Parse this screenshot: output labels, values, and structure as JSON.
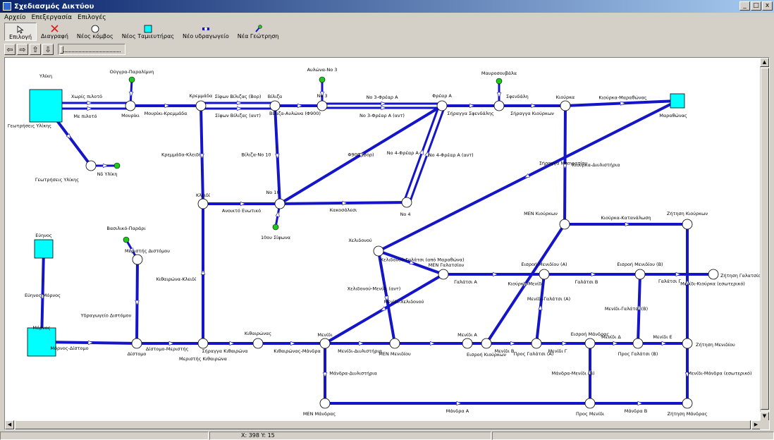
{
  "window": {
    "title": "Σχεδιασμός Δικτύου",
    "buttons": [
      "_",
      "□",
      "x"
    ]
  },
  "menu": [
    "Αρχείο",
    "Επεξεργασία",
    "Επιλογές"
  ],
  "toolbar": [
    {
      "label": "Επιλογή",
      "icon": "cursor-icon",
      "active": true
    },
    {
      "label": "Διαγραφή",
      "icon": "delete-x-icon",
      "active": false
    },
    {
      "label": "Νέος κόμβος",
      "icon": "node-circle-icon",
      "active": false
    },
    {
      "label": "Νέος Ταμιευτήρας",
      "icon": "reservoir-square-icon",
      "active": false
    },
    {
      "label": "Νέο υδραγωγείο",
      "icon": "aqueduct-icon",
      "active": false
    },
    {
      "label": "Νέα Γεώτρηση",
      "icon": "borehole-icon",
      "active": false
    }
  ],
  "nav": [
    "⇦",
    "⇨",
    "⇧",
    "⇩"
  ],
  "status": {
    "coords": "X: 398 Y: 15"
  },
  "colors": {
    "link": "#1414c8",
    "node_fill": "#ffffff",
    "reservoir": "#00ffff",
    "borehole": "#1ec81e"
  },
  "network": {
    "nodes": [
      {
        "id": "ylikis",
        "label": "Υλίκη",
        "type": "reservoir"
      },
      {
        "id": "mourikio",
        "label": "Μουρίκι",
        "type": "node"
      },
      {
        "id": "oygg",
        "label": "Ούγγρα-Παραλίμνη",
        "type": "borehole"
      },
      {
        "id": "kremmida",
        "label": "Κρεμμάδα",
        "type": "node"
      },
      {
        "id": "vilitza",
        "label": "Βίλιζα",
        "type": "node"
      },
      {
        "id": "avl",
        "label": "Αυλώνα-Νο 3",
        "type": "borehole"
      },
      {
        "id": "no3",
        "label": "Νο 3",
        "type": "node"
      },
      {
        "id": "freara",
        "label": "Φρέαρ Α",
        "type": "node"
      },
      {
        "id": "mavros",
        "label": "Μαυροσουβάλα",
        "type": "borehole"
      },
      {
        "id": "sfend",
        "label": "Σφενδάλη",
        "type": "node"
      },
      {
        "id": "kiourka",
        "label": "Κιούρκα",
        "type": "node"
      },
      {
        "id": "marath",
        "label": "Μαραθώνας",
        "type": "reservoir"
      },
      {
        "id": "geoyl",
        "label": "Γεωτρήσεις Υλίκης",
        "type": "node"
      },
      {
        "id": "ndyl",
        "label": "Νδ Υλίκη",
        "type": "borehole"
      },
      {
        "id": "kleidi",
        "label": "Κλειδί",
        "type": "node"
      },
      {
        "id": "no10",
        "label": "Νο 10",
        "type": "node"
      },
      {
        "id": "sifona10",
        "label": "10ου Σίφωνα",
        "type": "borehole"
      },
      {
        "id": "no4",
        "label": "Νο 4",
        "type": "node"
      },
      {
        "id": "menkiou",
        "label": "ΜΕΝ Κιούρκων",
        "type": "node"
      },
      {
        "id": "zitkiou",
        "label": "Ζήτηση Κιούρκων",
        "type": "node"
      },
      {
        "id": "chelid",
        "label": "Χελιδονού",
        "type": "node"
      },
      {
        "id": "mengal",
        "label": "ΜΕΝ Γαλατσίου",
        "type": "node"
      },
      {
        "id": "eismenA",
        "label": "Εισροή Μενιδίου (Α)",
        "type": "node"
      },
      {
        "id": "eismenB",
        "label": "Εισροή Μενιδίου (Β)",
        "type": "node"
      },
      {
        "id": "zitgal",
        "label": "Ζήτηση Γαλατσίου",
        "type": "node"
      },
      {
        "id": "evinos",
        "label": "Εύηνος",
        "type": "reservoir"
      },
      {
        "id": "vasil",
        "label": "Βασιλικό-Παράρι",
        "type": "borehole"
      },
      {
        "id": "merdist",
        "label": "Μεριστής Διστόμου",
        "type": "node"
      },
      {
        "id": "mornos",
        "label": "Μόρνος",
        "type": "reservoir"
      },
      {
        "id": "distomo",
        "label": "Δίστομο",
        "type": "node"
      },
      {
        "id": "merkith",
        "label": "Μεριστής Κιθαιρώνα",
        "type": "node"
      },
      {
        "id": "kithair",
        "label": "Κιθαιρώνας",
        "type": "node"
      },
      {
        "id": "menidi",
        "label": "Μενίδι",
        "type": "node"
      },
      {
        "id": "menmen",
        "label": "ΜΕΝ Μενιδίου",
        "type": "node"
      },
      {
        "id": "menidiA",
        "label": "Μενίδι Α",
        "type": "node"
      },
      {
        "id": "eiskiou",
        "label": "Εισροή Κιούρκων",
        "type": "node"
      },
      {
        "id": "prosgalA",
        "label": "Προς Γαλάτσι (Α)",
        "type": "node"
      },
      {
        "id": "eismandra",
        "label": "Εισροή Μάνδρας",
        "type": "node"
      },
      {
        "id": "prosgalB",
        "label": "Προς Γαλάτσι (Β)",
        "type": "node"
      },
      {
        "id": "zitmen",
        "label": "Ζήτηση Μενιδίου",
        "type": "node"
      },
      {
        "id": "menmandra",
        "label": "ΜΕΝ Μάνδρας",
        "type": "node"
      },
      {
        "id": "prosmen",
        "label": "Προς Μενίδι",
        "type": "node"
      },
      {
        "id": "zitmandra",
        "label": "Ζήτηση Μάνδρας",
        "type": "node"
      }
    ],
    "link_labels": [
      "Χωρίς πιλοτό",
      "Με πιλοτό",
      "Μουρίκι-Κρεμμάδα",
      "Σίφων Βίλιζας (Βορ)",
      "Σίφων Βίλιζας (ανт)",
      "Βίλιζα-Αυλώνα (Φ900)",
      "Νο 3-Φρέαρ Α",
      "Νο 3-Φρέαρ Α (ανт)",
      "Σήραγγα Σφενδάλης",
      "Σήραγγα Κιούρκων",
      "Κιούρκα-Μαραθώνας",
      "Γεωτρήσεις Υλίκης",
      "Κρεμμάδα-Κλειδί",
      "Βίλιζα-Νο 10",
      "Φ900 (Βορ)",
      "Νο 4-Φρέαρ Α",
      "Νο 4-Φρέαρ Α (ανт)",
      "Κιούρκα-Διυλιστήρια",
      "Σήραγγα Μπογιατίου",
      "Ανοικτό Ενωτικό",
      "Κακοσάλεσι",
      "Κιούρκα-Κατανάλωση",
      "Χελιδονού-Γαλάτσι (από Μαραθώνα)",
      "Κιούρκα-Μενίδι",
      "Γαλάτσι Α",
      "Γαλάτσι Β",
      "Γαλάτσι Γ",
      "Μενίδι-Κιούρκα (εσωτερικό)",
      "Χελιδονού-Μενίδι (ανт)",
      "Μενίδι-Χελιδονού",
      "Μενίδι-Γαλάτσι (Β)",
      "Μενίδι-Γαλάτσι (Α)",
      "Εύηνος-Μόρνος",
      "Υδραγωγείο Διστόμου",
      "Κιθαιρώνα-Κλειδί",
      "Μόρνος-Δίστομο",
      "Δίστομο-Μεριστής",
      "Σήραγγα Κιθαιρώνα",
      "Κιθαιρώνας-Μάνδρα",
      "Μενίδι-Διυλιστήρια",
      "Μενίδι Β",
      "Μενίδι Γ",
      "Μενίδι Δ",
      "Μενίδι Ε",
      "Μενίδι-Μάνδρα (εσωτερικό)",
      "Μάνδρα-Διυλιστήρια",
      "Μάνδρα-Μενίδι (Β)",
      "Μάνδρα Α",
      "Μάνδρα Β"
    ]
  }
}
